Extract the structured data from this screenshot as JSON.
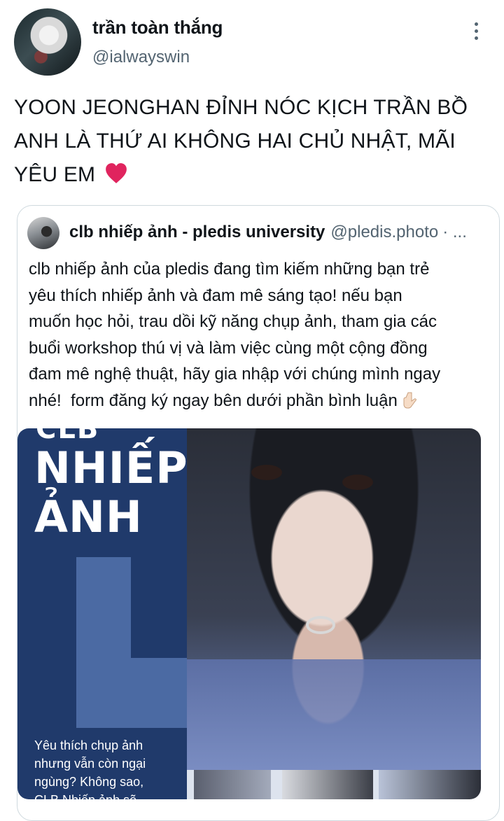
{
  "author": {
    "name": "trần toàn thắng",
    "handle": "@ialwayswin"
  },
  "tweet": {
    "text": "YOON JEONGHAN ĐỈNH NÓC KỊCH TRẦN BỒ\nANH LÀ THỨ AI KHÔNG HAI CHỦ NHẬT, MÃI\nYÊU EM",
    "emoji": "heart-emoji"
  },
  "quote": {
    "name": "clb nhiếp ảnh - pledis university",
    "handle": "@pledis.photo",
    "separator": "· ...",
    "text": "clb nhiếp ảnh của pledis đang tìm kiếm những bạn trẻ\nyêu thích nhiếp ảnh và đam mê sáng tạo! nếu bạn\nmuốn học hỏi, trau dồi kỹ năng chụp ảnh, tham gia các\nbuổi workshop thú vị và làm việc cùng một cộng đồng\nđam mê nghệ thuật, hãy gia nhập với chúng mình ngay\nnhé!  form đăng ký ngay bên dưới phần bình luận",
    "emoji": "pointing-down-emoji"
  },
  "poster": {
    "clb": "CLB",
    "title": "NHIẾP\nẢNH",
    "caption": "Yêu thích chụp ảnh\nnhưng vẫn còn ngại\nngùng? Không sao,\nCLB Nhiếp ảnh sẽ"
  },
  "colors": {
    "text": "#0f1419",
    "secondary": "#536471",
    "border": "#cfd9de",
    "poster_blue": "#203a6b",
    "poster_accent": "#4b6aa3"
  }
}
